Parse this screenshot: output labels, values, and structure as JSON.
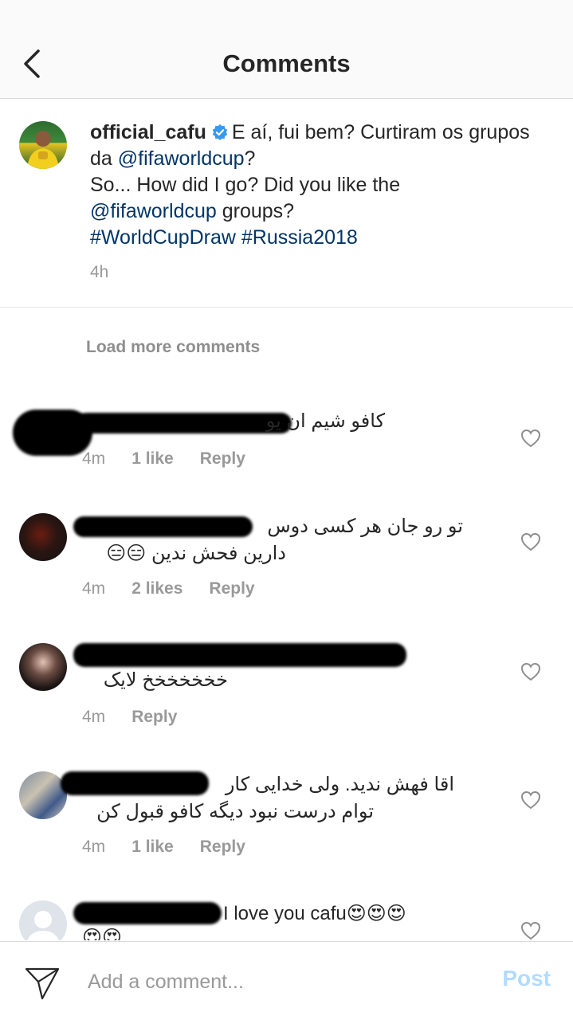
{
  "header": {
    "title": "Comments"
  },
  "caption": {
    "username": "official_cafu",
    "text_part1": "E aí, fui bem? Curtiram os grupos da ",
    "mention1": "@fifaworldcup",
    "text_part2": "?",
    "text_part3": "So... How did I go? Did you like the ",
    "mention2": "@fifaworldcup",
    "text_part4": " groups?",
    "hashtag1": "#WorldCupDraw",
    "hashtag2": "#Russia2018",
    "time": "4h"
  },
  "load_more": "Load more comments",
  "comments": [
    {
      "text": "کافو شیم ان یو",
      "time": "4m",
      "likes": "1 like",
      "reply": "Reply"
    },
    {
      "text_line1": "تو رو جان هر کسی دوس",
      "text_line2": "دارین فحش ندین 😑😑",
      "time": "4m",
      "likes": "2 likes",
      "reply": "Reply"
    },
    {
      "text": "خخخخخخخ لایک",
      "time": "4m",
      "reply": "Reply"
    },
    {
      "text_line1": "اقا فهش ندید. ولی خدایی کار",
      "text_line2": "توام درست نبود دیگه کافو قبول کن",
      "time": "4m",
      "likes": "1 like",
      "reply": "Reply"
    },
    {
      "text": "I love you cafu😍😍😍",
      "text_line2": "😍😍"
    }
  ],
  "input": {
    "placeholder": "Add a comment...",
    "post_label": "Post"
  },
  "colors": {
    "link": "#003569",
    "muted": "#999999",
    "post_disabled": "#b3dbff",
    "verified": "#3897f0"
  }
}
